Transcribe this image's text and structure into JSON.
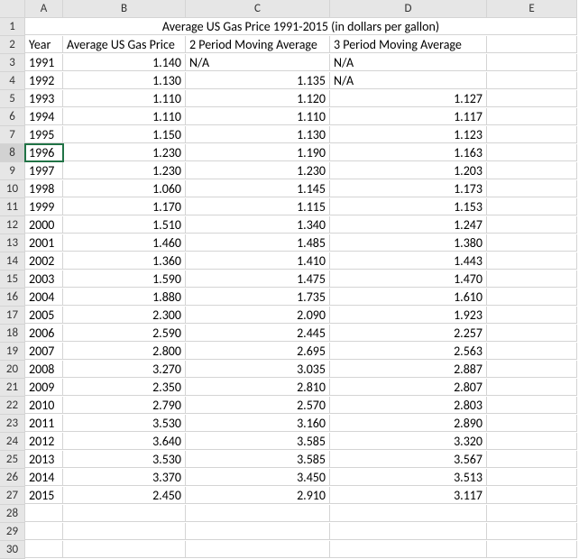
{
  "columns": [
    "A",
    "B",
    "C",
    "D",
    "E"
  ],
  "title": "Average US Gas Price 1991-2015 (in dollars per gallon)",
  "headers": {
    "year": "Year",
    "price": "Average US Gas Price",
    "ma2": "2 Period Moving Average",
    "ma3": "3 Period Moving Average"
  },
  "na": "N/A",
  "active_row": 8,
  "rows": [
    {
      "r": 3,
      "year": "1991",
      "price": "1.140",
      "ma2": "N/A",
      "ma3": "N/A",
      "ma2_txt": true,
      "ma3_txt": true
    },
    {
      "r": 4,
      "year": "1992",
      "price": "1.130",
      "ma2": "1.135",
      "ma3": "N/A",
      "ma3_txt": true
    },
    {
      "r": 5,
      "year": "1993",
      "price": "1.110",
      "ma2": "1.120",
      "ma3": "1.127"
    },
    {
      "r": 6,
      "year": "1994",
      "price": "1.110",
      "ma2": "1.110",
      "ma3": "1.117"
    },
    {
      "r": 7,
      "year": "1995",
      "price": "1.150",
      "ma2": "1.130",
      "ma3": "1.123"
    },
    {
      "r": 8,
      "year": "1996",
      "price": "1.230",
      "ma2": "1.190",
      "ma3": "1.163"
    },
    {
      "r": 9,
      "year": "1997",
      "price": "1.230",
      "ma2": "1.230",
      "ma3": "1.203"
    },
    {
      "r": 10,
      "year": "1998",
      "price": "1.060",
      "ma2": "1.145",
      "ma3": "1.173"
    },
    {
      "r": 11,
      "year": "1999",
      "price": "1.170",
      "ma2": "1.115",
      "ma3": "1.153"
    },
    {
      "r": 12,
      "year": "2000",
      "price": "1.510",
      "ma2": "1.340",
      "ma3": "1.247"
    },
    {
      "r": 13,
      "year": "2001",
      "price": "1.460",
      "ma2": "1.485",
      "ma3": "1.380"
    },
    {
      "r": 14,
      "year": "2002",
      "price": "1.360",
      "ma2": "1.410",
      "ma3": "1.443"
    },
    {
      "r": 15,
      "year": "2003",
      "price": "1.590",
      "ma2": "1.475",
      "ma3": "1.470"
    },
    {
      "r": 16,
      "year": "2004",
      "price": "1.880",
      "ma2": "1.735",
      "ma3": "1.610"
    },
    {
      "r": 17,
      "year": "2005",
      "price": "2.300",
      "ma2": "2.090",
      "ma3": "1.923"
    },
    {
      "r": 18,
      "year": "2006",
      "price": "2.590",
      "ma2": "2.445",
      "ma3": "2.257"
    },
    {
      "r": 19,
      "year": "2007",
      "price": "2.800",
      "ma2": "2.695",
      "ma3": "2.563"
    },
    {
      "r": 20,
      "year": "2008",
      "price": "3.270",
      "ma2": "3.035",
      "ma3": "2.887"
    },
    {
      "r": 21,
      "year": "2009",
      "price": "2.350",
      "ma2": "2.810",
      "ma3": "2.807"
    },
    {
      "r": 22,
      "year": "2010",
      "price": "2.790",
      "ma2": "2.570",
      "ma3": "2.803"
    },
    {
      "r": 23,
      "year": "2011",
      "price": "3.530",
      "ma2": "3.160",
      "ma3": "2.890"
    },
    {
      "r": 24,
      "year": "2012",
      "price": "3.640",
      "ma2": "3.585",
      "ma3": "3.320"
    },
    {
      "r": 25,
      "year": "2013",
      "price": "3.530",
      "ma2": "3.585",
      "ma3": "3.567"
    },
    {
      "r": 26,
      "year": "2014",
      "price": "3.370",
      "ma2": "3.450",
      "ma3": "3.513"
    },
    {
      "r": 27,
      "year": "2015",
      "price": "2.450",
      "ma2": "2.910",
      "ma3": "3.117"
    }
  ],
  "empty_rows": [
    28,
    29,
    30
  ],
  "chart_data": {
    "type": "table",
    "title": "Average US Gas Price 1991-2015 (in dollars per gallon)",
    "columns": [
      "Year",
      "Average US Gas Price",
      "2 Period Moving Average",
      "3 Period Moving Average"
    ],
    "data": [
      [
        1991,
        1.14,
        null,
        null
      ],
      [
        1992,
        1.13,
        1.135,
        null
      ],
      [
        1993,
        1.11,
        1.12,
        1.127
      ],
      [
        1994,
        1.11,
        1.11,
        1.117
      ],
      [
        1995,
        1.15,
        1.13,
        1.123
      ],
      [
        1996,
        1.23,
        1.19,
        1.163
      ],
      [
        1997,
        1.23,
        1.23,
        1.203
      ],
      [
        1998,
        1.06,
        1.145,
        1.173
      ],
      [
        1999,
        1.17,
        1.115,
        1.153
      ],
      [
        2000,
        1.51,
        1.34,
        1.247
      ],
      [
        2001,
        1.46,
        1.485,
        1.38
      ],
      [
        2002,
        1.36,
        1.41,
        1.443
      ],
      [
        2003,
        1.59,
        1.475,
        1.47
      ],
      [
        2004,
        1.88,
        1.735,
        1.61
      ],
      [
        2005,
        2.3,
        2.09,
        1.923
      ],
      [
        2006,
        2.59,
        2.445,
        2.257
      ],
      [
        2007,
        2.8,
        2.695,
        2.563
      ],
      [
        2008,
        3.27,
        3.035,
        2.887
      ],
      [
        2009,
        2.35,
        2.81,
        2.807
      ],
      [
        2010,
        2.79,
        2.57,
        2.803
      ],
      [
        2011,
        3.53,
        3.16,
        2.89
      ],
      [
        2012,
        3.64,
        3.585,
        3.32
      ],
      [
        2013,
        3.53,
        3.585,
        3.567
      ],
      [
        2014,
        3.37,
        3.45,
        3.513
      ],
      [
        2015,
        2.45,
        2.91,
        3.117
      ]
    ]
  }
}
